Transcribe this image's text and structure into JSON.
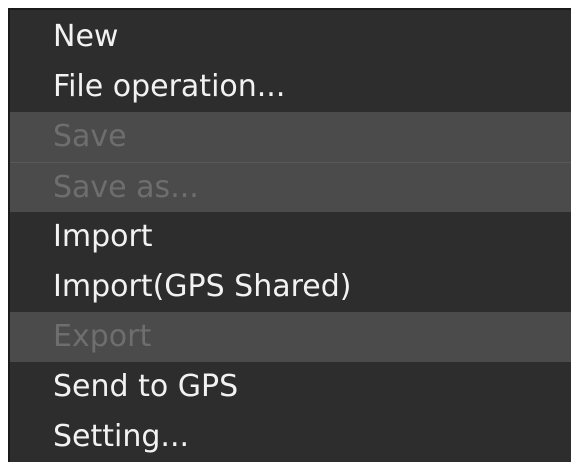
{
  "menu": {
    "items": [
      {
        "label": "New",
        "enabled": true
      },
      {
        "label": "File operation...",
        "enabled": true
      },
      {
        "label": "Save",
        "enabled": false
      },
      {
        "label": "Save as...",
        "enabled": false
      },
      {
        "label": "Import",
        "enabled": true
      },
      {
        "label": "Import(GPS Shared)",
        "enabled": true
      },
      {
        "label": "Export",
        "enabled": false
      },
      {
        "label": "Send to GPS",
        "enabled": true
      },
      {
        "label": "Setting...",
        "enabled": true
      }
    ]
  },
  "colors": {
    "menu_background": "#2d2d2d",
    "disabled_background": "#4b4b4b",
    "enabled_text": "#f2f2f2",
    "disabled_text": "#6e6e6e"
  }
}
